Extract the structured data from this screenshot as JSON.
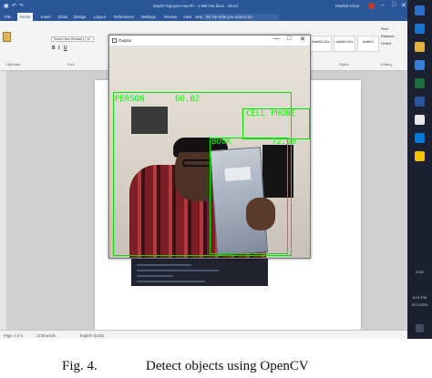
{
  "word": {
    "title": "Day07-Nguyen-HuuTri - 1-M8 Hm.docx - Word",
    "user": "Mashid Khan",
    "tabs": [
      "File",
      "Home",
      "Insert",
      "Draw",
      "Design",
      "Layout",
      "References",
      "Mailings",
      "Review",
      "View",
      "Help"
    ],
    "active_tab": "Home",
    "tell_me": "Tell me what you want to do",
    "font_name": "Times New Roman",
    "font_size": "10",
    "styles": [
      "AaBbCcDc",
      "AaBbCcDc",
      "AaBbC"
    ],
    "style_names": [
      "Normal",
      "No Spac...",
      "Heading 1"
    ],
    "group_labels": [
      "Clipboard",
      "Font",
      "Paragraph",
      "Styles",
      "Editing"
    ],
    "editing": [
      "Find",
      "Replace",
      "Select"
    ],
    "status": {
      "page": "Page 4 of 5",
      "words": "1738 words",
      "language": "English (India)"
    }
  },
  "cv_window": {
    "title": "Output",
    "controls": [
      "—",
      "□",
      "✕"
    ]
  },
  "detections": [
    {
      "label": "PERSON",
      "score": "60.02"
    },
    {
      "label": "CELL PHONE",
      "score": ""
    },
    {
      "label": "BOOK",
      "score": "72.18"
    }
  ],
  "taskbar": {
    "time": "6:02 PM",
    "date": "5/17/2022",
    "lang": "ENG"
  },
  "caption": {
    "number": "Fig. 4.",
    "text": "Detect objects using OpenCV"
  },
  "colors": {
    "word_blue": "#2b579a",
    "detection_green": "#00ff00",
    "taskbar": "#1b2130"
  }
}
